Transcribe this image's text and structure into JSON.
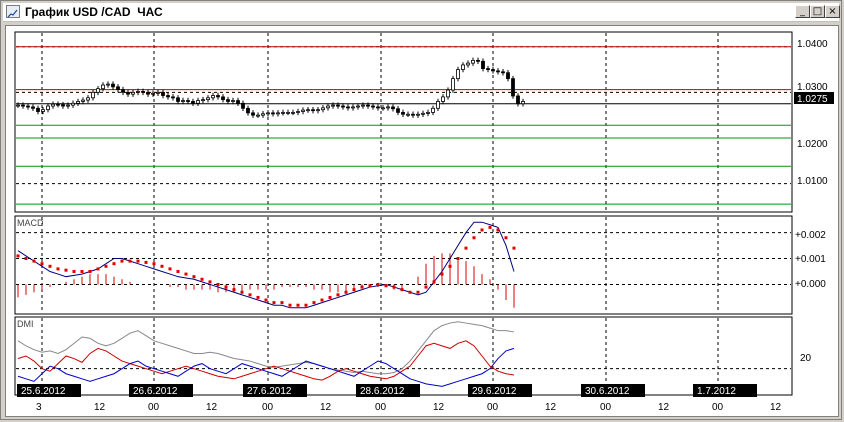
{
  "window": {
    "title": "График USD /CAD  ЧАС",
    "minimize_glyph": "_",
    "maximize_glyph": "□",
    "close_glyph": "×"
  },
  "colors": {
    "background": "#ffffff",
    "grid": "#000000",
    "resistance_lines": "#cc0000",
    "support_lines": "#009900",
    "macd_line": "#000080",
    "signal_dots": "#dd0000",
    "histogram": "#dd0000",
    "dmi_adx": "#888888",
    "dmi_plus": "#cc0000",
    "dmi_minus": "#0000cc",
    "price_marker_bg": "#000000",
    "date_label_bg": "#000000"
  },
  "price_panel": {
    "y_ticks": [
      "1.0400",
      "1.0300",
      "1.0200",
      "1.0100"
    ],
    "current_price": "1.0275",
    "horizontal_lines": [
      {
        "price": 1.04,
        "color": "red"
      },
      {
        "price": 1.0306,
        "color": "red"
      },
      {
        "price": 1.0228,
        "color": "green"
      },
      {
        "price": 1.02,
        "color": "green"
      },
      {
        "price": 1.0138,
        "color": "green"
      },
      {
        "price": 1.0055,
        "color": "green"
      }
    ]
  },
  "macd_panel": {
    "label": "MACD",
    "y_ticks": [
      "+0.002",
      "+0.001",
      "+0.000"
    ]
  },
  "dmi_panel": {
    "label": "DMI",
    "y_ticks": [
      "20"
    ]
  },
  "time_axis": {
    "date_labels": [
      "25.6.2012",
      "26.6.2012",
      "27.6.2012",
      "28.6.2012",
      "29.6.2012",
      "30.6.2012",
      "1.7.2012"
    ],
    "hour_labels": [
      [
        "3",
        "12"
      ],
      [
        "00",
        "12"
      ],
      [
        "00",
        "12"
      ],
      [
        "00",
        "12"
      ],
      [
        "00",
        "12"
      ],
      [
        "00",
        "12"
      ],
      [
        "00",
        "12"
      ]
    ]
  },
  "chart_data": [
    {
      "type": "candlestick",
      "title": "",
      "y_range": [
        1.004,
        1.043
      ],
      "y_ticks": [
        1.04,
        1.03,
        1.02,
        1.01
      ],
      "current_value": 1.0275,
      "close": [
        1.0272,
        1.027,
        1.0268,
        1.0265,
        1.0258,
        1.0262,
        1.027,
        1.0274,
        1.0273,
        1.027,
        1.0272,
        1.0276,
        1.028,
        1.0283,
        1.0288,
        1.03,
        1.0308,
        1.0316,
        1.0318,
        1.0312,
        1.0306,
        1.03,
        1.0296,
        1.03,
        1.0302,
        1.03,
        1.0296,
        1.0298,
        1.03,
        1.0293,
        1.029,
        1.0288,
        1.028,
        1.0282,
        1.028,
        1.0276,
        1.0282,
        1.0284,
        1.0288,
        1.0293,
        1.029,
        1.0284,
        1.028,
        1.0282,
        1.0276,
        1.0265,
        1.0255,
        1.025,
        1.025,
        1.0253,
        1.0255,
        1.0253,
        1.0255,
        1.0256,
        1.0256,
        1.0256,
        1.0258,
        1.0261,
        1.0262,
        1.026,
        1.0262,
        1.0266,
        1.027,
        1.0272,
        1.027,
        1.0268,
        1.0266,
        1.0268,
        1.027,
        1.0272,
        1.027,
        1.0268,
        1.0266,
        1.0266,
        1.0268,
        1.0264,
        1.0256,
        1.0252,
        1.0252,
        1.025,
        1.0252,
        1.0254,
        1.0256,
        1.0265,
        1.028,
        1.029,
        1.0305,
        1.033,
        1.035,
        1.036,
        1.0364,
        1.037,
        1.0368,
        1.0352,
        1.035,
        1.0347,
        1.0345,
        1.0343,
        1.033,
        1.0292,
        1.0275,
        1.028
      ]
    },
    {
      "type": "line",
      "title": "MACD",
      "y_range": [
        -0.0011,
        0.0026
      ],
      "y_ticks": [
        0.002,
        0.001,
        0.0
      ],
      "series": [
        {
          "name": "",
          "role": "macd",
          "values": [
            0.0013,
            0.0011,
            0.0009,
            0.0007,
            0.0005,
            0.0004,
            0.0003,
            0.00035,
            0.0004,
            0.0005,
            0.0006,
            0.0008,
            0.001,
            0.001,
            0.0009,
            0.0008,
            0.0007,
            0.0006,
            0.0005,
            0.0004,
            0.0003,
            0.00025,
            0.0002,
            0.0001,
            0.0,
            -0.0001,
            -0.0002,
            -0.0003,
            -0.0004,
            -0.0005,
            -0.0006,
            -0.0007,
            -0.0008,
            -0.0008,
            -0.0009,
            -0.0009,
            -0.0009,
            -0.0008,
            -0.0007,
            -0.0006,
            -0.0005,
            -0.0004,
            -0.0003,
            -0.0002,
            -0.0001,
            -5e-05,
            0.0,
            -0.0001,
            -0.0002,
            -0.0003,
            -0.0004,
            -0.0003,
            0.0001,
            0.0005,
            0.001,
            0.0015,
            0.002,
            0.0024,
            0.0024,
            0.0023,
            0.0022,
            0.0015,
            0.0005
          ]
        },
        {
          "name": "",
          "role": "signal",
          "values": [
            0.0011,
            0.001,
            0.0009,
            0.0008,
            0.0007,
            0.0006,
            0.00055,
            0.0005,
            0.0005,
            0.0005,
            0.0006,
            0.0007,
            0.0008,
            0.0009,
            0.0009,
            0.0009,
            0.00085,
            0.0008,
            0.0007,
            0.0006,
            0.0005,
            0.0004,
            0.0003,
            0.0002,
            0.0001,
            0.0,
            -0.0001,
            -0.0002,
            -0.0003,
            -0.0004,
            -0.0005,
            -0.0006,
            -0.0007,
            -0.0007,
            -0.0008,
            -0.0008,
            -0.0008,
            -0.0007,
            -0.0006,
            -0.0005,
            -0.0004,
            -0.0003,
            -0.0002,
            -0.0001,
            -5e-05,
            0.0,
            -5e-05,
            -0.0001,
            -0.0002,
            -0.0003,
            -0.0003,
            -0.0001,
            0.0001,
            0.0004,
            0.0007,
            0.001,
            0.0014,
            0.0018,
            0.0021,
            0.0022,
            0.0021,
            0.0018,
            0.0014
          ]
        },
        {
          "name": "",
          "role": "histogram",
          "values": [
            -0.0005,
            -0.0004,
            -0.0003,
            -0.0002,
            -0.0001,
            0.0,
            0.0001,
            0.0002,
            0.0003,
            0.0004,
            0.0004,
            0.0004,
            0.0003,
            0.0002,
            0.0001,
            0.0,
            0.0,
            0.0,
            0.0,
            -0.0001,
            -0.0001,
            -0.0002,
            -0.0002,
            -0.0002,
            -0.0002,
            -0.0003,
            -0.0003,
            -0.0003,
            -0.0003,
            -0.0002,
            -0.0002,
            -0.0002,
            -0.0002,
            -0.0001,
            -0.0001,
            -0.0001,
            -0.0001,
            -0.0002,
            -0.0002,
            -0.0003,
            -0.0003,
            -0.0003,
            -0.0002,
            -0.0001,
            -0.0001,
            -0.0001,
            -0.0001,
            -0.0002,
            -0.0002,
            0.0,
            0.0003,
            0.0008,
            0.0011,
            0.0012,
            0.0012,
            0.001,
            0.0009,
            0.0007,
            0.0004,
            0.0002,
            -0.0002,
            -0.0006,
            -0.0009
          ]
        }
      ]
    },
    {
      "type": "line",
      "title": "DMI",
      "y_range": [
        0,
        60
      ],
      "y_ticks": [
        20
      ],
      "series": [
        {
          "name": "",
          "role": "adx",
          "values": [
            42,
            38,
            35,
            33,
            34,
            32,
            35,
            40,
            45,
            44,
            40,
            38,
            40,
            44,
            48,
            50,
            46,
            42,
            40,
            38,
            36,
            34,
            32,
            32,
            33,
            32,
            30,
            28,
            27,
            26,
            24,
            22,
            21,
            22,
            23,
            24,
            25,
            24,
            22,
            20,
            19,
            18,
            17,
            18,
            17,
            16,
            16,
            17,
            20,
            26,
            34,
            42,
            50,
            54,
            56,
            57,
            56,
            55,
            54,
            52,
            50,
            50,
            49
          ]
        },
        {
          "name": "",
          "role": "plus_di",
          "values": [
            28,
            30,
            26,
            20,
            18,
            24,
            30,
            28,
            25,
            32,
            36,
            34,
            30,
            26,
            24,
            22,
            20,
            18,
            16,
            18,
            20,
            22,
            20,
            18,
            16,
            14,
            13,
            12,
            14,
            16,
            18,
            20,
            22,
            20,
            18,
            16,
            14,
            12,
            11,
            14,
            18,
            20,
            18,
            16,
            14,
            13,
            12,
            14,
            18,
            22,
            30,
            38,
            40,
            38,
            36,
            40,
            42,
            38,
            30,
            22,
            18,
            16,
            15
          ]
        },
        {
          "name": "",
          "role": "minus_di",
          "values": [
            14,
            12,
            10,
            16,
            22,
            20,
            16,
            14,
            12,
            10,
            12,
            14,
            16,
            20,
            24,
            26,
            22,
            20,
            18,
            16,
            14,
            18,
            22,
            24,
            20,
            18,
            16,
            20,
            24,
            22,
            20,
            18,
            16,
            14,
            18,
            22,
            26,
            24,
            22,
            20,
            18,
            16,
            14,
            18,
            22,
            26,
            24,
            20,
            16,
            12,
            10,
            8,
            7,
            6,
            8,
            10,
            12,
            14,
            16,
            20,
            28,
            34,
            36
          ]
        }
      ]
    }
  ]
}
